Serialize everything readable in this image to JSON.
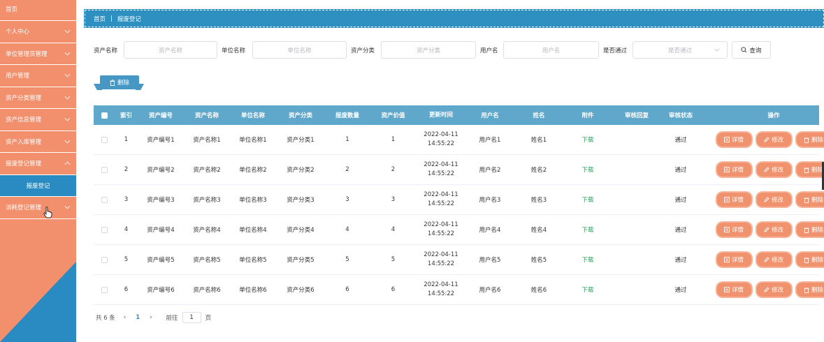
{
  "sidebar": {
    "items": [
      {
        "label": "首页"
      },
      {
        "label": "个人中心"
      },
      {
        "label": "单位管理员管理"
      },
      {
        "label": "用户管理"
      },
      {
        "label": "资产分类管理"
      },
      {
        "label": "资产信息管理"
      },
      {
        "label": "资产入库管理"
      },
      {
        "label": "报废登记管理"
      }
    ],
    "sub_item": {
      "label": "报废登记"
    },
    "last_item": {
      "label": "消耗登记管理"
    },
    "accent_color": "#f28f6d",
    "active_color": "#2a8bc2"
  },
  "breadcrumb": {
    "home": "首页",
    "separator": "|",
    "current": "报废登记"
  },
  "search": {
    "fields": [
      {
        "label": "资产名称",
        "placeholder": "资产名称"
      },
      {
        "label": "单位名称",
        "placeholder": "单位名称"
      },
      {
        "label": "资产分类",
        "placeholder": "资产分类"
      },
      {
        "label": "用户名",
        "placeholder": "用户名"
      }
    ],
    "select": {
      "label": "是否通过",
      "placeholder": "是否通过"
    },
    "button": "查询"
  },
  "toolbar": {
    "delete_label": "删除"
  },
  "table": {
    "headers": [
      "索引",
      "资产编号",
      "资产名称",
      "单位名称",
      "资产分类",
      "报废数量",
      "资产价值",
      "更新时间",
      "用户名",
      "姓名",
      "附件",
      "审核回复",
      "审核状态",
      "操作"
    ],
    "rows": [
      {
        "index": "1",
        "code": "资产编号1",
        "name": "资产名称1",
        "unit": "单位名称1",
        "category": "资产分类1",
        "qty": "1",
        "value": "1",
        "date": "2022-04-11",
        "time": "14:55:22",
        "user": "用户名1",
        "realname": "姓名1",
        "attachment": "下载",
        "reply": "",
        "status": "通过"
      },
      {
        "index": "2",
        "code": "资产编号2",
        "name": "资产名称2",
        "unit": "单位名称2",
        "category": "资产分类2",
        "qty": "2",
        "value": "2",
        "date": "2022-04-11",
        "time": "14:55:22",
        "user": "用户名2",
        "realname": "姓名2",
        "attachment": "下载",
        "reply": "",
        "status": "通过"
      },
      {
        "index": "3",
        "code": "资产编号3",
        "name": "资产名称3",
        "unit": "单位名称3",
        "category": "资产分类3",
        "qty": "3",
        "value": "3",
        "date": "2022-04-11",
        "time": "14:55:22",
        "user": "用户名3",
        "realname": "姓名3",
        "attachment": "下载",
        "reply": "",
        "status": "通过"
      },
      {
        "index": "4",
        "code": "资产编号4",
        "name": "资产名称4",
        "unit": "单位名称4",
        "category": "资产分类4",
        "qty": "4",
        "value": "4",
        "date": "2022-04-11",
        "time": "14:55:22",
        "user": "用户名4",
        "realname": "姓名4",
        "attachment": "下载",
        "reply": "",
        "status": "通过"
      },
      {
        "index": "5",
        "code": "资产编号5",
        "name": "资产名称5",
        "unit": "单位名称5",
        "category": "资产分类5",
        "qty": "5",
        "value": "5",
        "date": "2022-04-11",
        "time": "14:55:22",
        "user": "用户名5",
        "realname": "姓名5",
        "attachment": "下载",
        "reply": "",
        "status": "通过"
      },
      {
        "index": "6",
        "code": "资产编号6",
        "name": "资产名称6",
        "unit": "单位名称6",
        "category": "资产分类6",
        "qty": "6",
        "value": "6",
        "date": "2022-04-11",
        "time": "14:55:22",
        "user": "用户名6",
        "realname": "姓名6",
        "attachment": "下载",
        "reply": "",
        "status": "通过"
      }
    ],
    "ops": {
      "detail": "详情",
      "edit": "修改",
      "delete": "删除"
    }
  },
  "pager": {
    "total": "共 6 条",
    "current": "1",
    "goto_label": "前往",
    "goto_value": "1",
    "page_suffix": "页"
  }
}
